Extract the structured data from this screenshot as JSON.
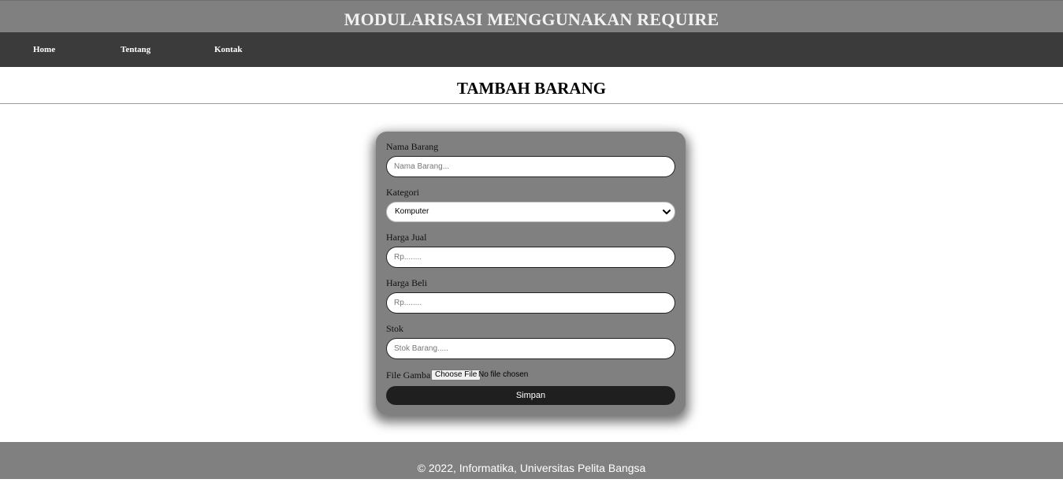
{
  "header": {
    "title": "MODULARISASI MENGGUNAKAN REQUIRE"
  },
  "nav": {
    "items": [
      "Home",
      "Tentang",
      "Kontak"
    ]
  },
  "page": {
    "title": "TAMBAH BARANG"
  },
  "form": {
    "nama_barang": {
      "label": "Nama Barang",
      "placeholder": "Nama Barang...",
      "value": ""
    },
    "kategori": {
      "label": "Kategori",
      "selected": "Komputer"
    },
    "harga_jual": {
      "label": "Harga Jual",
      "placeholder": "Rp........",
      "value": ""
    },
    "harga_beli": {
      "label": "Harga Beli",
      "placeholder": "Rp........",
      "value": ""
    },
    "stok": {
      "label": "Stok",
      "placeholder": "Stok Barang.....",
      "value": ""
    },
    "file_gambar": {
      "label": "File Gambar",
      "button_label": "Choose File",
      "status": "No file chosen"
    },
    "submit_label": "Simpan"
  },
  "footer": {
    "text": "© 2022, Informatika, Universitas Pelita Bangsa"
  },
  "colors": {
    "header_bg": "#808080",
    "nav_bg": "#3c3b3b",
    "card_bg": "#808080",
    "button_bg": "#1f1f1f",
    "footer_bg": "#808080"
  },
  "icons": {
    "select_arrow": "chevron-down-icon"
  }
}
